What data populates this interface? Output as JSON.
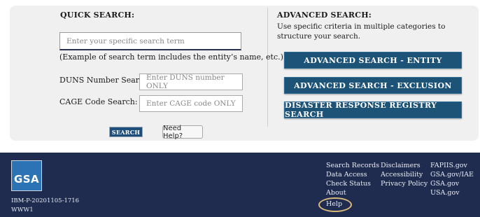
{
  "quick": {
    "heading": "QUICK SEARCH:",
    "placeholder": "Enter your specific search term",
    "example": "(Example of search term includes the entity’s name, etc.)",
    "duns_label": "DUNS Number Search:",
    "duns_placeholder": "Enter DUNS number ONLY",
    "cage_label": "CAGE Code Search:",
    "cage_placeholder": "Enter CAGE code ONLY",
    "search_button": "SEARCH",
    "help_button": "Need Help?"
  },
  "advanced": {
    "heading": "ADVANCED SEARCH:",
    "description": "Use specific criteria in multiple categories to structure your search.",
    "buttons": [
      "ADVANCED SEARCH - ENTITY",
      "ADVANCED SEARCH - EXCLUSION",
      "DISASTER RESPONSE REGISTRY SEARCH"
    ]
  },
  "footer": {
    "logo_text": "GSA",
    "build_id": "IBM-P-20201105-1716",
    "server": "WWW1",
    "col1": [
      "Search Records",
      "Data Access",
      "Check Status",
      "About",
      "Help"
    ],
    "col2": [
      "Disclaimers",
      "Accessibility",
      "Privacy Policy"
    ],
    "col3": [
      "FAPIIS.gov",
      "GSA.gov/IAE",
      "GSA.gov",
      "USA.gov"
    ]
  },
  "colors": {
    "button_blue": "#1e5378",
    "footer_navy": "#1f2c50",
    "help_highlight": "#d9b97b"
  }
}
